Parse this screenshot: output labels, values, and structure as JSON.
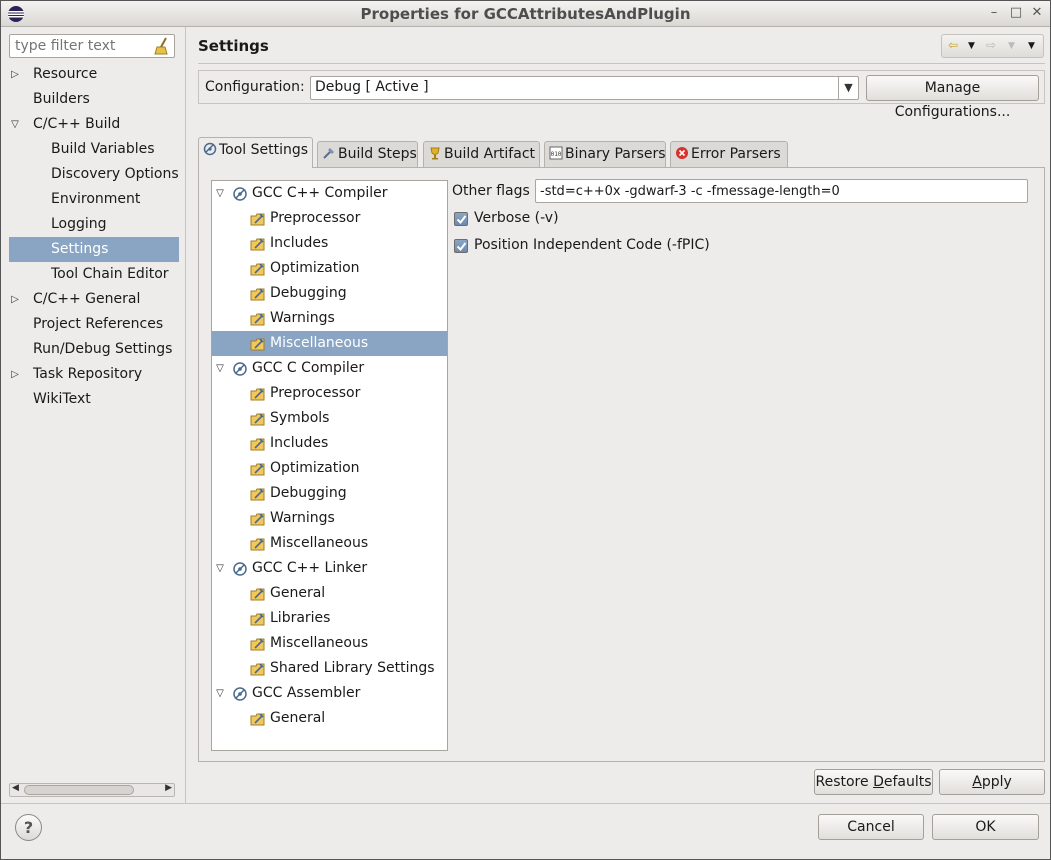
{
  "window": {
    "title": "Properties for GCCAttributesAndPlugin",
    "controls": [
      "–",
      "□",
      "✕"
    ]
  },
  "filter": {
    "placeholder": "type filter text"
  },
  "nav": [
    {
      "label": "Resource",
      "level": 0,
      "twisty": "closed"
    },
    {
      "label": "Builders",
      "level": 0,
      "twisty": ""
    },
    {
      "label": "C/C++ Build",
      "level": 0,
      "twisty": "open"
    },
    {
      "label": "Build Variables",
      "level": 1,
      "twisty": ""
    },
    {
      "label": "Discovery Options",
      "level": 1,
      "twisty": ""
    },
    {
      "label": "Environment",
      "level": 1,
      "twisty": ""
    },
    {
      "label": "Logging",
      "level": 1,
      "twisty": ""
    },
    {
      "label": "Settings",
      "level": 1,
      "twisty": "",
      "selected": true
    },
    {
      "label": "Tool Chain Editor",
      "level": 1,
      "twisty": ""
    },
    {
      "label": "C/C++ General",
      "level": 0,
      "twisty": "closed"
    },
    {
      "label": "Project References",
      "level": 0,
      "twisty": ""
    },
    {
      "label": "Run/Debug Settings",
      "level": 0,
      "twisty": ""
    },
    {
      "label": "Task Repository",
      "level": 0,
      "twisty": "closed"
    },
    {
      "label": "WikiText",
      "level": 0,
      "twisty": ""
    }
  ],
  "page": {
    "title": "Settings"
  },
  "configuration": {
    "label": "Configuration:",
    "value": "Debug  [ Active ]",
    "manage_label": "Manage Configurations..."
  },
  "tabs": [
    {
      "label": "Tool Settings",
      "icon": "tool-settings-icon",
      "active": true
    },
    {
      "label": "Build Steps",
      "icon": "build-steps-icon"
    },
    {
      "label": "Build Artifact",
      "icon": "build-artifact-icon"
    },
    {
      "label": "Binary Parsers",
      "icon": "binary-parsers-icon"
    },
    {
      "label": "Error Parsers",
      "icon": "error-parsers-icon"
    }
  ],
  "tool_tree": [
    {
      "label": "GCC C++ Compiler",
      "type": "tool"
    },
    {
      "label": "Preprocessor",
      "type": "option"
    },
    {
      "label": "Includes",
      "type": "option"
    },
    {
      "label": "Optimization",
      "type": "option"
    },
    {
      "label": "Debugging",
      "type": "option"
    },
    {
      "label": "Warnings",
      "type": "option"
    },
    {
      "label": "Miscellaneous",
      "type": "option",
      "selected": true
    },
    {
      "label": "GCC C Compiler",
      "type": "tool"
    },
    {
      "label": "Preprocessor",
      "type": "option"
    },
    {
      "label": "Symbols",
      "type": "option"
    },
    {
      "label": "Includes",
      "type": "option"
    },
    {
      "label": "Optimization",
      "type": "option"
    },
    {
      "label": "Debugging",
      "type": "option"
    },
    {
      "label": "Warnings",
      "type": "option"
    },
    {
      "label": "Miscellaneous",
      "type": "option"
    },
    {
      "label": "GCC C++ Linker",
      "type": "tool"
    },
    {
      "label": "General",
      "type": "option"
    },
    {
      "label": "Libraries",
      "type": "option"
    },
    {
      "label": "Miscellaneous",
      "type": "option"
    },
    {
      "label": "Shared Library Settings",
      "type": "option"
    },
    {
      "label": "GCC Assembler",
      "type": "tool"
    },
    {
      "label": "General",
      "type": "option"
    }
  ],
  "options": {
    "other_flags_label": "Other flags",
    "other_flags_value": "-std=c++0x -gdwarf-3 -c -fmessage-length=0",
    "verbose_label": "Verbose (-v)",
    "verbose_checked": true,
    "pic_label": "Position Independent Code (-fPIC)",
    "pic_checked": true
  },
  "buttons": {
    "restore_pre": "Restore ",
    "restore_mn": "D",
    "restore_post": "efaults",
    "apply_pre": "",
    "apply_mn": "A",
    "apply_post": "pply",
    "cancel": "Cancel",
    "ok": "OK",
    "help": "?"
  },
  "colors": {
    "selection": "#8aa5c4",
    "background": "#edeceb"
  }
}
